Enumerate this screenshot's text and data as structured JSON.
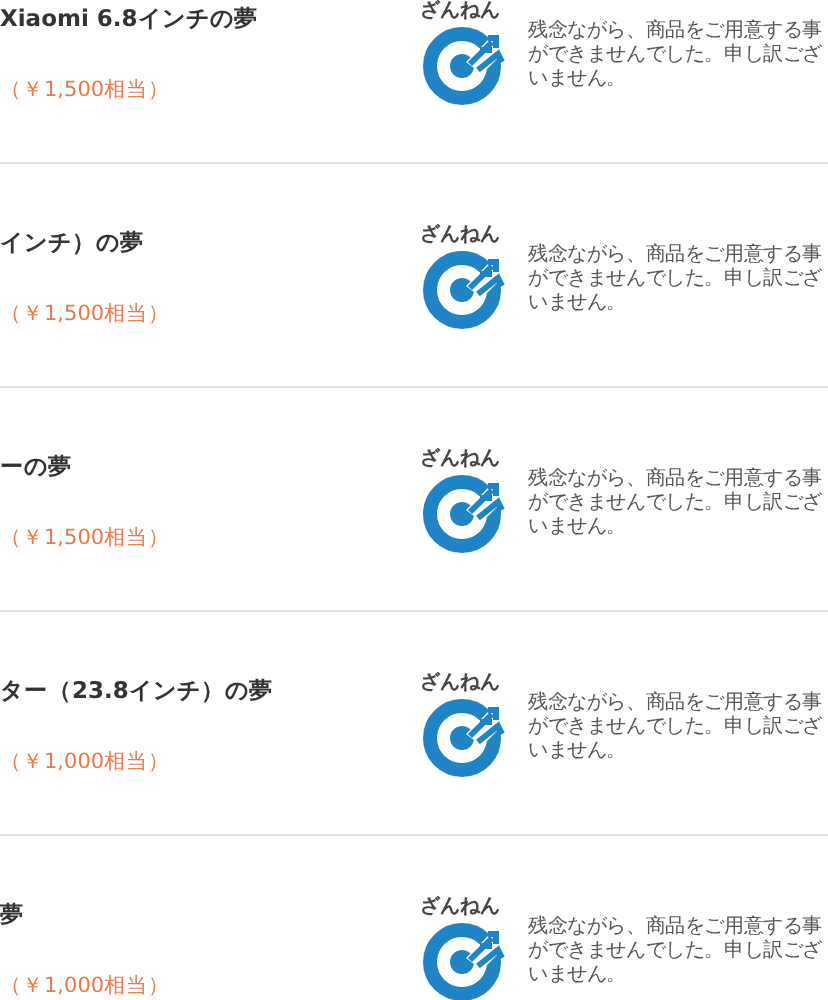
{
  "items": [
    {
      "title": "Xiaomi 6.8インチの夢",
      "price": "（￥1,500相当）",
      "result_label": "ざんねん",
      "message": "残念ながら、商品をご用意する事ができませんでした。申し訳ございません。"
    },
    {
      "title": "インチ）の夢",
      "price": "（￥1,500相当）",
      "result_label": "ざんねん",
      "message": "残念ながら、商品をご用意する事ができませんでした。申し訳ございません。"
    },
    {
      "title": "ーの夢",
      "price": "（￥1,500相当）",
      "result_label": "ざんねん",
      "message": "残念ながら、商品をご用意する事ができませんでした。申し訳ございません。"
    },
    {
      "title": "ター（23.8インチ）の夢",
      "price": "（￥1,000相当）",
      "result_label": "ざんねん",
      "message": "残念ながら、商品をご用意する事ができませんでした。申し訳ございません。"
    },
    {
      "title": "夢",
      "price": "（￥1,000相当）",
      "result_label": "ざんねん",
      "message": "残念ながら、商品をご用意する事ができませんでした。申し訳ございません。"
    }
  ]
}
